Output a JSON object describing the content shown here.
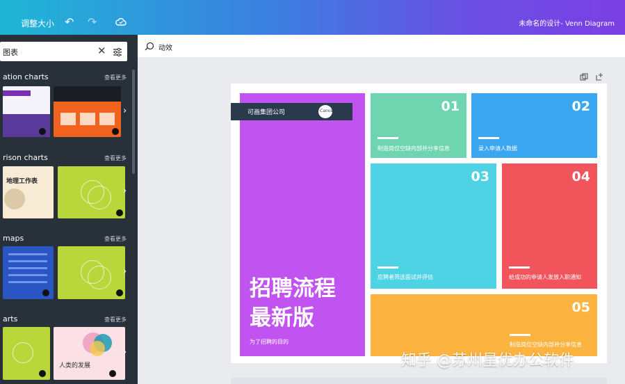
{
  "topbar": {
    "resize_label": "调整大小",
    "doc_title": "未命名的设计- Venn Diagram"
  },
  "sidebar": {
    "search_value": "图表",
    "sections": [
      {
        "title": "ation charts",
        "more": "查看更多"
      },
      {
        "title": "rison charts",
        "more": "查看更多"
      },
      {
        "title": "maps",
        "more": "查看更多"
      },
      {
        "title": "arts",
        "more": "查看更多"
      }
    ],
    "thumbs": {
      "geo_title": "地理工作表",
      "dev_title": "人类的发展"
    }
  },
  "toolbar": {
    "animate_label": "动效"
  },
  "design": {
    "company": "可画集团公司",
    "logo": "Canva",
    "title_line1": "招聘流程",
    "title_line2": "最新版",
    "subtitle": "为了招聘的目的",
    "steps": [
      {
        "num": "01",
        "caption": "制造岗位空缺内部并分享信息",
        "color": "#6fd5b0"
      },
      {
        "num": "02",
        "caption": "录入申请人数据",
        "color": "#3aa7f0"
      },
      {
        "num": "03",
        "caption": "应聘者筛选面试并评估",
        "color": "#4ed3e4"
      },
      {
        "num": "04",
        "caption": "给成功的申请人发放入职通知",
        "color": "#f2545b"
      },
      {
        "num": "05",
        "caption": "制造岗位空缺内部并分享信息",
        "color": "#fdb33f"
      }
    ],
    "accent_color": "#c154f0"
  },
  "watermark": "知乎 @苏州星优办公软件"
}
